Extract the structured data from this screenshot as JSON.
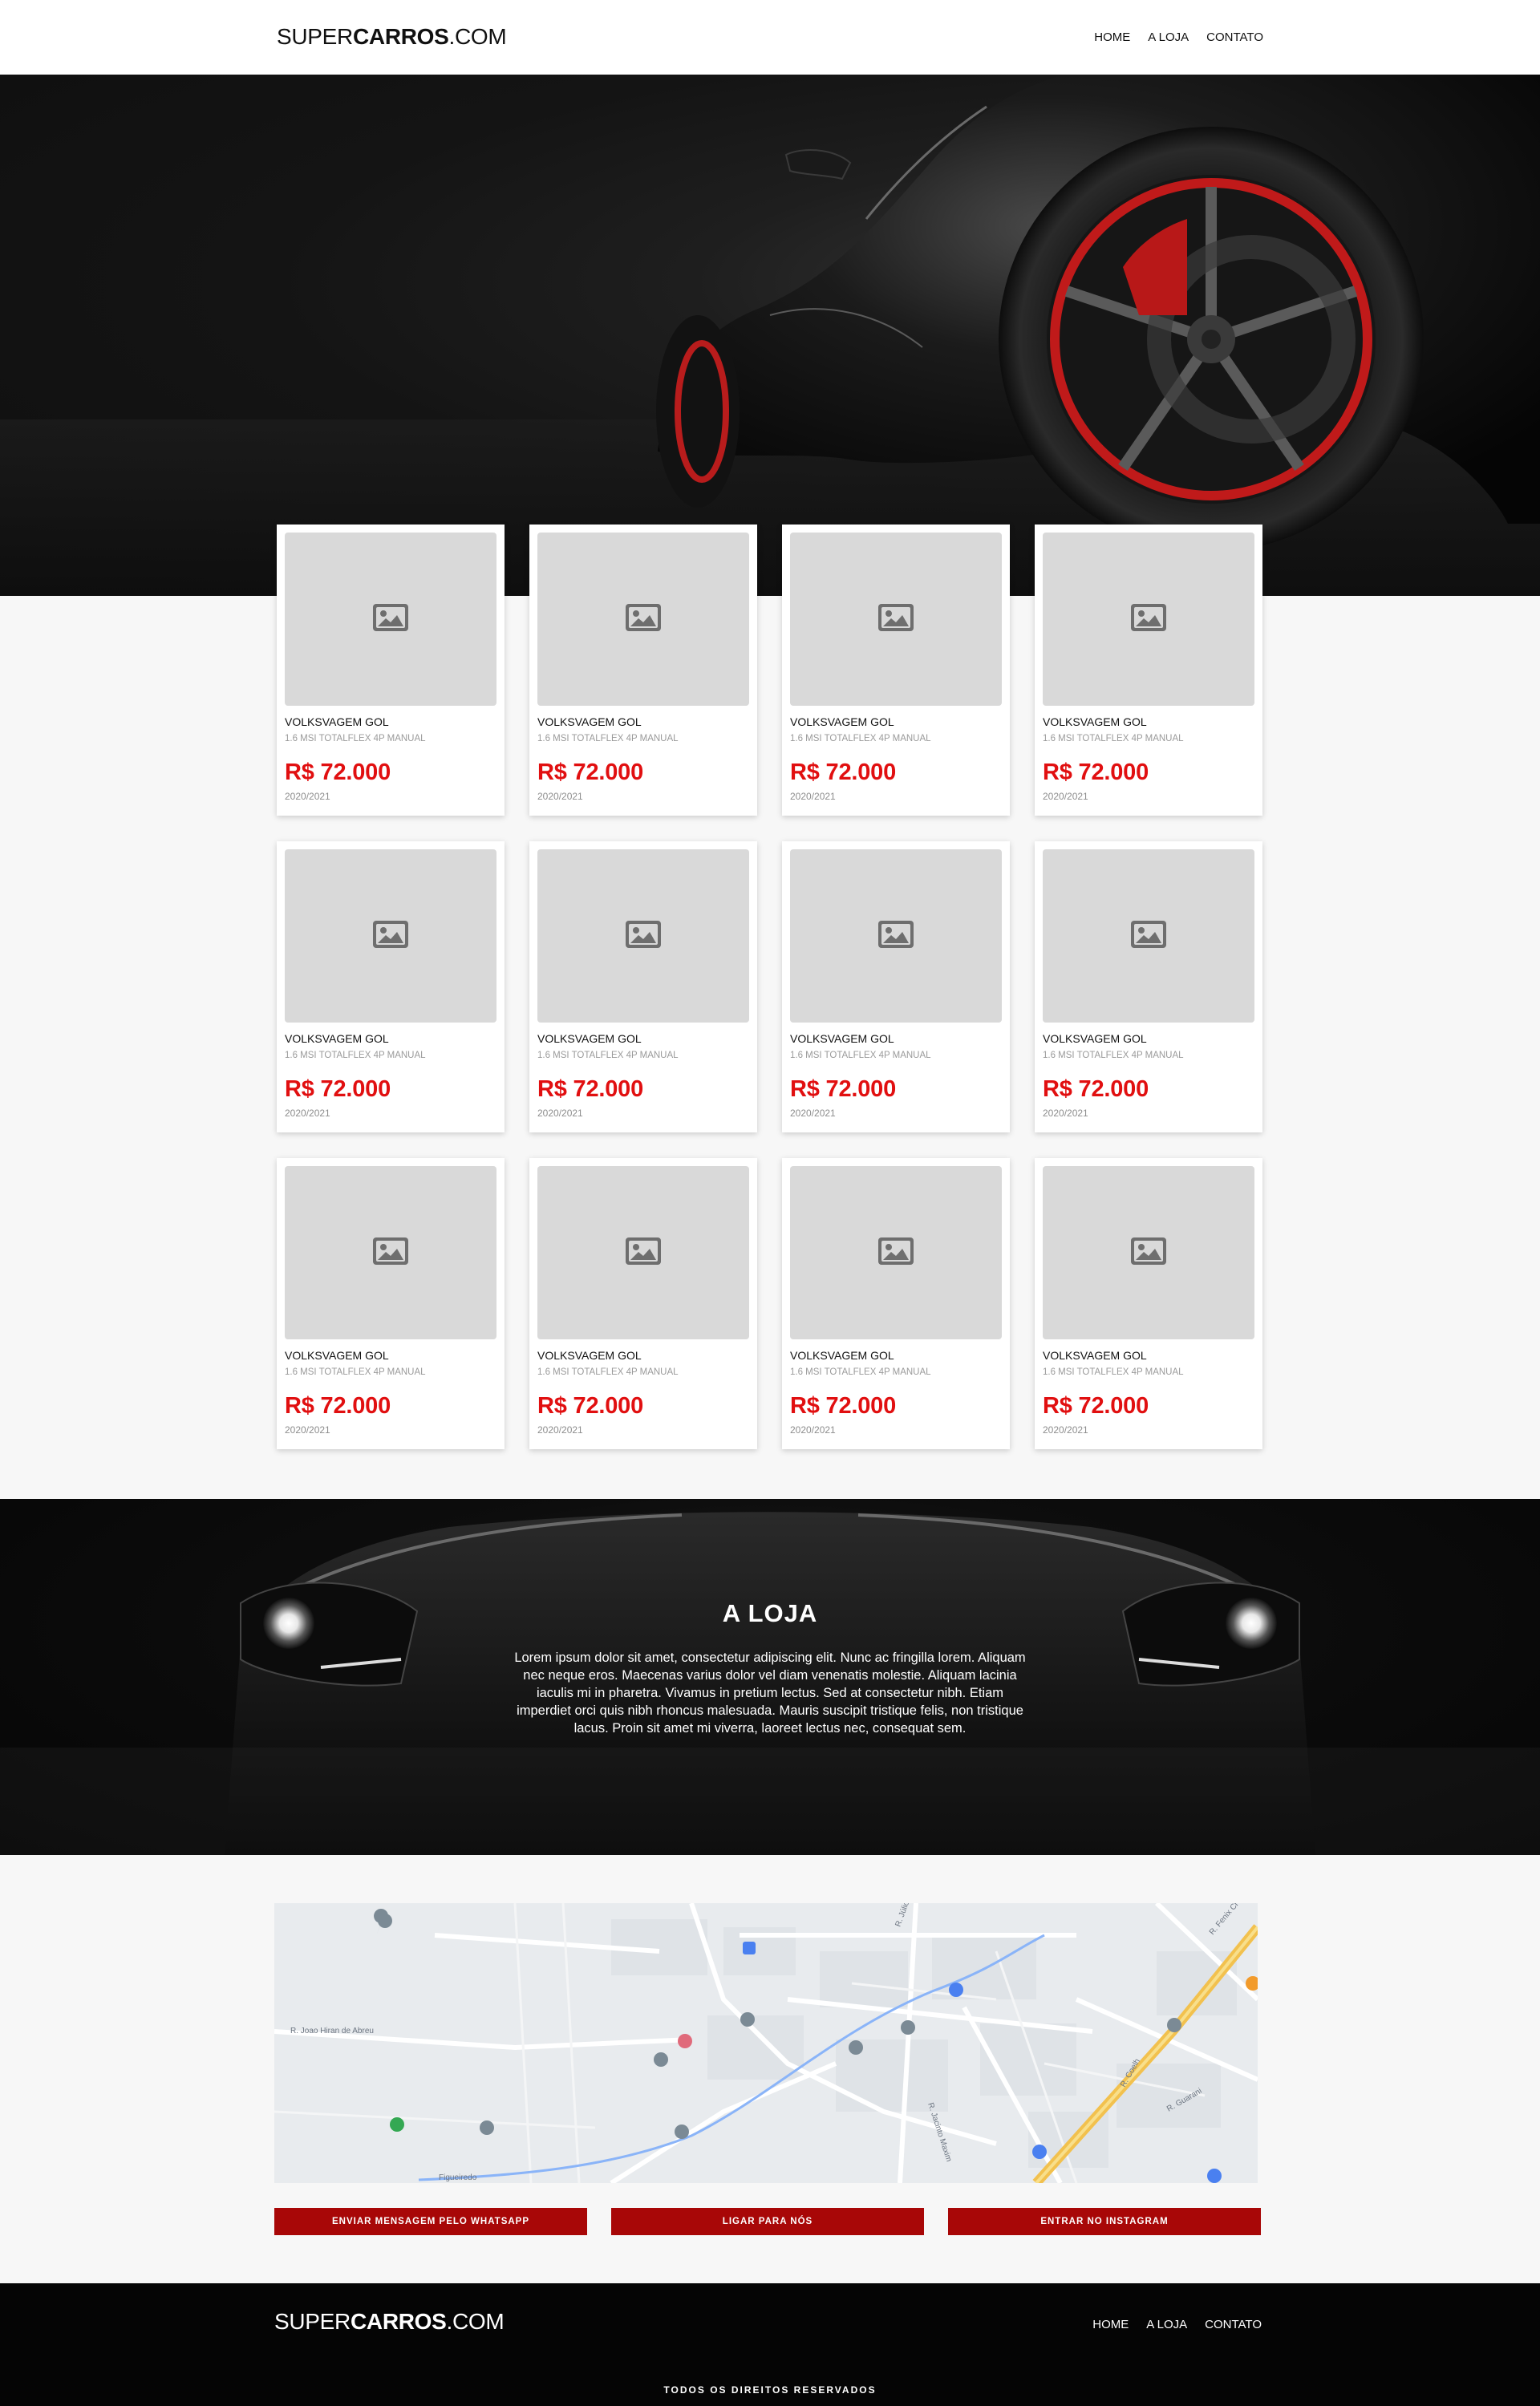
{
  "header": {
    "logo_light": "SUPER",
    "logo_bold": "CARROS",
    "logo_suffix": ".COM",
    "nav": [
      "HOME",
      "A LOJA",
      "CONTATO"
    ]
  },
  "listings": [
    {
      "title": "VOLKSVAGEM GOL",
      "subtitle": "1.6 MSI TOTALFLEX 4P MANUAL",
      "price": "R$ 72.000",
      "year": "2020/2021"
    },
    {
      "title": "VOLKSVAGEM GOL",
      "subtitle": "1.6 MSI TOTALFLEX 4P MANUAL",
      "price": "R$ 72.000",
      "year": "2020/2021"
    },
    {
      "title": "VOLKSVAGEM GOL",
      "subtitle": "1.6 MSI TOTALFLEX 4P MANUAL",
      "price": "R$ 72.000",
      "year": "2020/2021"
    },
    {
      "title": "VOLKSVAGEM GOL",
      "subtitle": "1.6 MSI TOTALFLEX 4P MANUAL",
      "price": "R$ 72.000",
      "year": "2020/2021"
    },
    {
      "title": "VOLKSVAGEM GOL",
      "subtitle": "1.6 MSI TOTALFLEX 4P MANUAL",
      "price": "R$ 72.000",
      "year": "2020/2021"
    },
    {
      "title": "VOLKSVAGEM GOL",
      "subtitle": "1.6 MSI TOTALFLEX 4P MANUAL",
      "price": "R$ 72.000",
      "year": "2020/2021"
    },
    {
      "title": "VOLKSVAGEM GOL",
      "subtitle": "1.6 MSI TOTALFLEX 4P MANUAL",
      "price": "R$ 72.000",
      "year": "2020/2021"
    },
    {
      "title": "VOLKSVAGEM GOL",
      "subtitle": "1.6 MSI TOTALFLEX 4P MANUAL",
      "price": "R$ 72.000",
      "year": "2020/2021"
    },
    {
      "title": "VOLKSVAGEM GOL",
      "subtitle": "1.6 MSI TOTALFLEX 4P MANUAL",
      "price": "R$ 72.000",
      "year": "2020/2021"
    },
    {
      "title": "VOLKSVAGEM GOL",
      "subtitle": "1.6 MSI TOTALFLEX 4P MANUAL",
      "price": "R$ 72.000",
      "year": "2020/2021"
    },
    {
      "title": "VOLKSVAGEM GOL",
      "subtitle": "1.6 MSI TOTALFLEX 4P MANUAL",
      "price": "R$ 72.000",
      "year": "2020/2021"
    },
    {
      "title": "VOLKSVAGEM GOL",
      "subtitle": "1.6 MSI TOTALFLEX 4P MANUAL",
      "price": "R$ 72.000",
      "year": "2020/2021"
    }
  ],
  "loja": {
    "title": "A LOJA",
    "text": "Lorem ipsum dolor sit amet, consectetur adipiscing elit. Nunc ac fringilla lorem. Aliquam nec neque eros. Maecenas varius dolor vel diam venenatis molestie. Aliquam lacinia iaculis mi in pharetra. Vivamus in pretium lectus. Sed at consectetur nibh. Etiam imperdiet orci quis nibh rhoncus malesuada. Mauris suscipit tristique felis, non tristique lacus. Proin sit amet mi viverra, laoreet lectus nec, consequat sem."
  },
  "map": {
    "street_labels": [
      "R. Joao Hiran de Abreu",
      "R. Júlio Rodr.",
      "R. Jacinto Maxim",
      "R. Coelh",
      "R. Guarani",
      "R. Fenix Cr",
      "Figueiredo"
    ]
  },
  "buttons": {
    "whatsapp": "ENVIAR MENSAGEM PELO WHATSAPP",
    "call": "LIGAR PARA NÓS",
    "instagram": "ENTRAR NO INSTAGRAM"
  },
  "footer": {
    "copyright": "TODOS OS DIREITOS RESERVADOS"
  },
  "colors": {
    "accent_price": "#e10f10",
    "button_bg": "#a80707",
    "dark_bg": "#050505"
  }
}
